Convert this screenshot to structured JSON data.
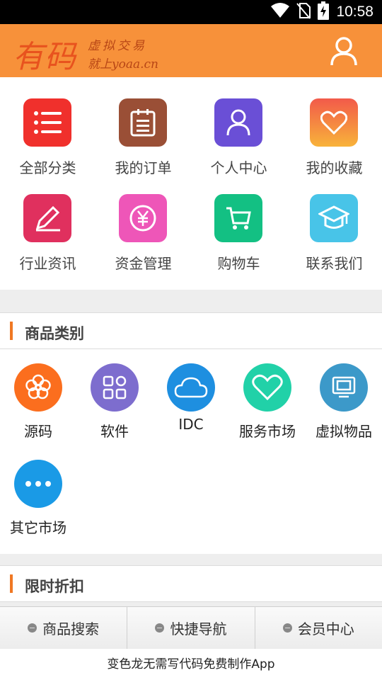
{
  "status_bar": {
    "time": "10:58",
    "icons": [
      "wifi-icon",
      "no-sim-icon",
      "battery-charging-icon"
    ]
  },
  "header": {
    "logo_main": "有码",
    "logo_sub1": "虚拟交易",
    "logo_sub2": "就上yoaa.cn",
    "bg_color": "#f7913a",
    "user_icon": "user-icon"
  },
  "grid": [
    {
      "label": "全部分类",
      "icon": "list-icon"
    },
    {
      "label": "我的订单",
      "icon": "clipboard-icon"
    },
    {
      "label": "个人中心",
      "icon": "person-icon"
    },
    {
      "label": "我的收藏",
      "icon": "heart-icon"
    },
    {
      "label": "行业资讯",
      "icon": "pencil-icon"
    },
    {
      "label": "资金管理",
      "icon": "yen-icon"
    },
    {
      "label": "购物车",
      "icon": "cart-icon"
    },
    {
      "label": "联系我们",
      "icon": "graduation-cap-icon"
    }
  ],
  "categories_section": {
    "title": "商品类别"
  },
  "categories": [
    {
      "label": "源码",
      "icon": "flower-icon",
      "color": "#fb6e1e"
    },
    {
      "label": "软件",
      "icon": "apps-icon",
      "color": "#7d6dce"
    },
    {
      "label": "IDC",
      "icon": "cloud-icon",
      "color": "#1e8fe0"
    },
    {
      "label": "服务市场",
      "icon": "heart-outline-icon",
      "color": "#21d1a8"
    },
    {
      "label": "虚拟物品",
      "icon": "monitor-icon",
      "color": "#3c99c9"
    },
    {
      "label": "其它市场",
      "icon": "more-icon",
      "color": "#1a9ae6"
    }
  ],
  "discount_section": {
    "title": "限时折扣"
  },
  "bottom_nav": [
    {
      "label": "商品搜索"
    },
    {
      "label": "快捷导航"
    },
    {
      "label": "会员中心"
    }
  ],
  "footer": {
    "text": "变色龙无需写代码免费制作App"
  }
}
